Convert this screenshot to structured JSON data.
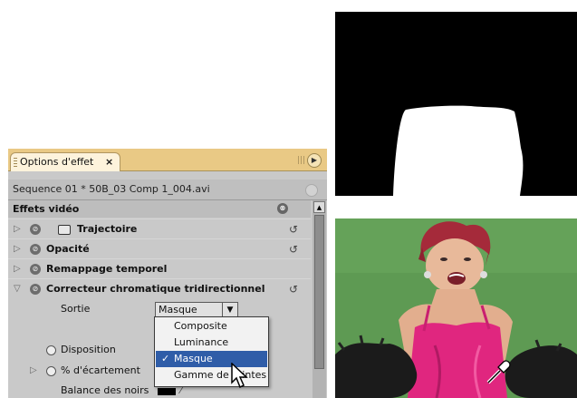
{
  "panel": {
    "tab_label": "Options d'effet",
    "tab_close": "×",
    "menu_icon": "flyout-menu-icon",
    "sequence_title": "Sequence 01 * 50B_03 Comp 1_004.avi",
    "section_title": "Effets vidéo",
    "section_toggle": "⊗",
    "effects": [
      {
        "name": "Trajectoire",
        "expanded": false
      },
      {
        "name": "Opacité",
        "expanded": false
      },
      {
        "name": "Remappage temporel",
        "expanded": false
      },
      {
        "name": "Correcteur chromatique tridirectionnel",
        "expanded": true
      }
    ],
    "reset_glyph": "↺",
    "properties": {
      "sortie_label": "Sortie",
      "sortie_value": "Masque",
      "disposition_label": "Disposition",
      "ecartement_label": "% d'écartement",
      "balance_noirs_label": "Balance des noirs"
    },
    "dropdown_options": [
      {
        "label": "Composite",
        "selected": false
      },
      {
        "label": "Luminance",
        "selected": false
      },
      {
        "label": "Masque",
        "selected": true
      },
      {
        "label": "Gamme de teintes",
        "selected": false
      }
    ],
    "check_glyph": "✓"
  },
  "colors": {
    "tab_bar": "#e9c985",
    "panel_bg": "#c9c9c9",
    "highlight": "#2f5da8",
    "video_bg": "#5a9550",
    "dress": "#e0267f"
  }
}
